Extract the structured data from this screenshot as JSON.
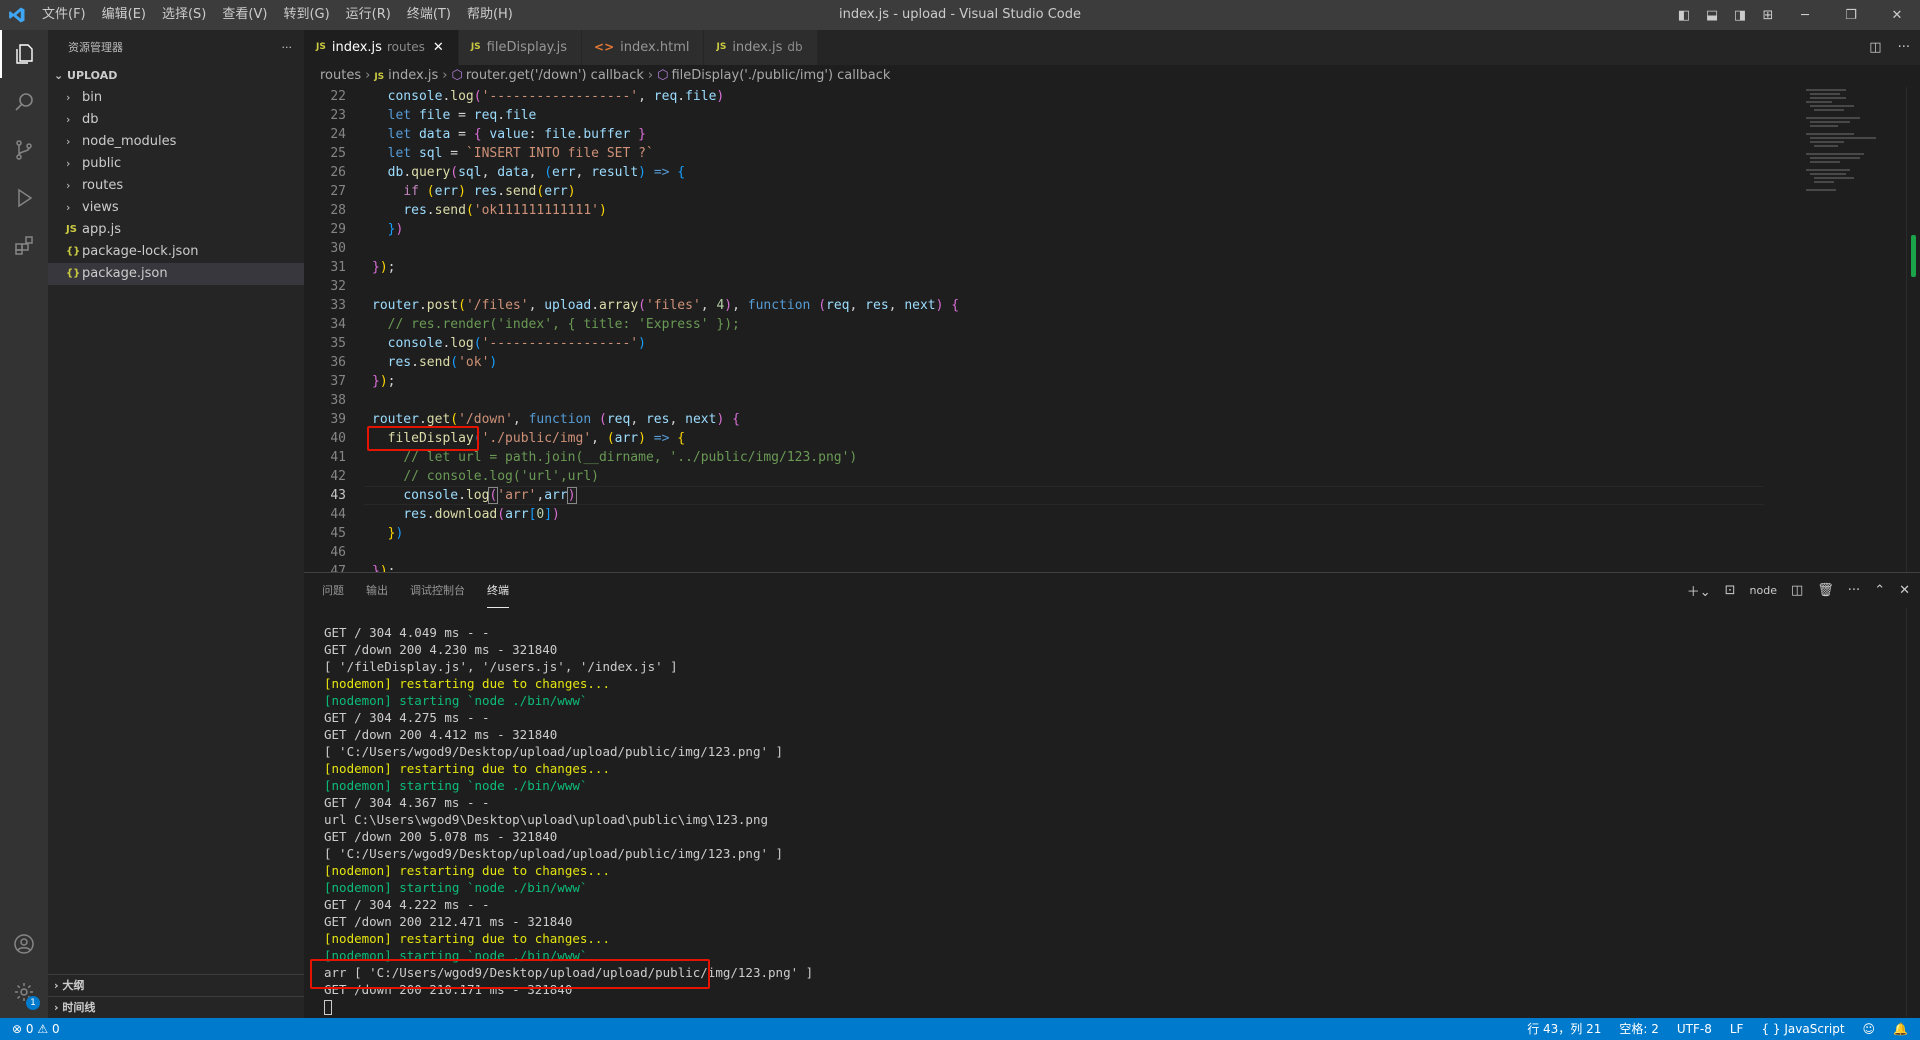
{
  "window": {
    "title": "index.js - upload - Visual Studio Code"
  },
  "menu": [
    "文件(F)",
    "编辑(E)",
    "选择(S)",
    "查看(V)",
    "转到(G)",
    "运行(R)",
    "终端(T)",
    "帮助(H)"
  ],
  "sidebar": {
    "header": "资源管理器",
    "more": "···",
    "root": "UPLOAD",
    "items": [
      {
        "label": "bin",
        "type": "folder"
      },
      {
        "label": "db",
        "type": "folder"
      },
      {
        "label": "node_modules",
        "type": "folder"
      },
      {
        "label": "public",
        "type": "folder"
      },
      {
        "label": "routes",
        "type": "folder"
      },
      {
        "label": "views",
        "type": "folder"
      },
      {
        "label": "app.js",
        "type": "js"
      },
      {
        "label": "package-lock.json",
        "type": "json"
      },
      {
        "label": "package.json",
        "type": "json"
      }
    ],
    "outline": "大纲",
    "timeline": "时间线"
  },
  "tabs": [
    {
      "label": "index.js",
      "desc": "routes",
      "icon": "JS",
      "active": true
    },
    {
      "label": "fileDisplay.js",
      "desc": "",
      "icon": "JS",
      "active": false
    },
    {
      "label": "index.html",
      "desc": "",
      "icon": "<>",
      "active": false
    },
    {
      "label": "index.js",
      "desc": "db",
      "icon": "JS",
      "active": false
    }
  ],
  "breadcrumb": [
    "routes",
    "index.js",
    "router.get('/down') callback",
    "fileDisplay('./public/img') callback"
  ],
  "editor": {
    "line_numbers": [
      "22",
      "23",
      "24",
      "25",
      "26",
      "27",
      "28",
      "29",
      "30",
      "31",
      "32",
      "33",
      "34",
      "35",
      "36",
      "37",
      "38",
      "39",
      "40",
      "41",
      "42",
      "43",
      "44",
      "45",
      "46",
      "47"
    ],
    "current_line": "43"
  },
  "panel": {
    "tabs": [
      "问题",
      "输出",
      "调试控制台",
      "终端"
    ],
    "active_tab": "终端",
    "terminal_name": "node",
    "lines": [
      "GET / 304 4.049 ms - -",
      "GET /down 200 4.230 ms - 321840",
      "[ '/fileDisplay.js', '/users.js', '/index.js' ]",
      "[nodemon] restarting due to changes...",
      "[nodemon] starting `node ./bin/www`",
      "GET / 304 4.275 ms - -",
      "GET /down 200 4.412 ms - 321840",
      "[ 'C:/Users/wgod9/Desktop/upload/upload/public/img/123.png' ]",
      "[nodemon] restarting due to changes...",
      "[nodemon] starting `node ./bin/www`",
      "GET / 304 4.367 ms - -",
      "url C:\\Users\\wgod9\\Desktop\\upload\\upload\\public\\img\\123.png",
      "GET /down 200 5.078 ms - 321840",
      "[ 'C:/Users/wgod9/Desktop/upload/upload/public/img/123.png' ]",
      "[nodemon] restarting due to changes...",
      "[nodemon] starting `node ./bin/www`",
      "GET / 304 4.222 ms - -",
      "GET /down 200 212.471 ms - 321840",
      "[nodemon] restarting due to changes...",
      "[nodemon] starting `node ./bin/www`",
      "arr [ 'C:/Users/wgod9/Desktop/upload/upload/public/img/123.png' ]",
      "GET /down 200 210.171 ms - 321840"
    ]
  },
  "statusbar": {
    "errors": "0",
    "warnings": "0",
    "position": "行 43，列 21",
    "spaces": "空格: 2",
    "encoding": "UTF-8",
    "eol": "LF",
    "language": "JavaScript"
  },
  "colors": {
    "accent": "#007acc",
    "highlight_box": "#e51400"
  }
}
